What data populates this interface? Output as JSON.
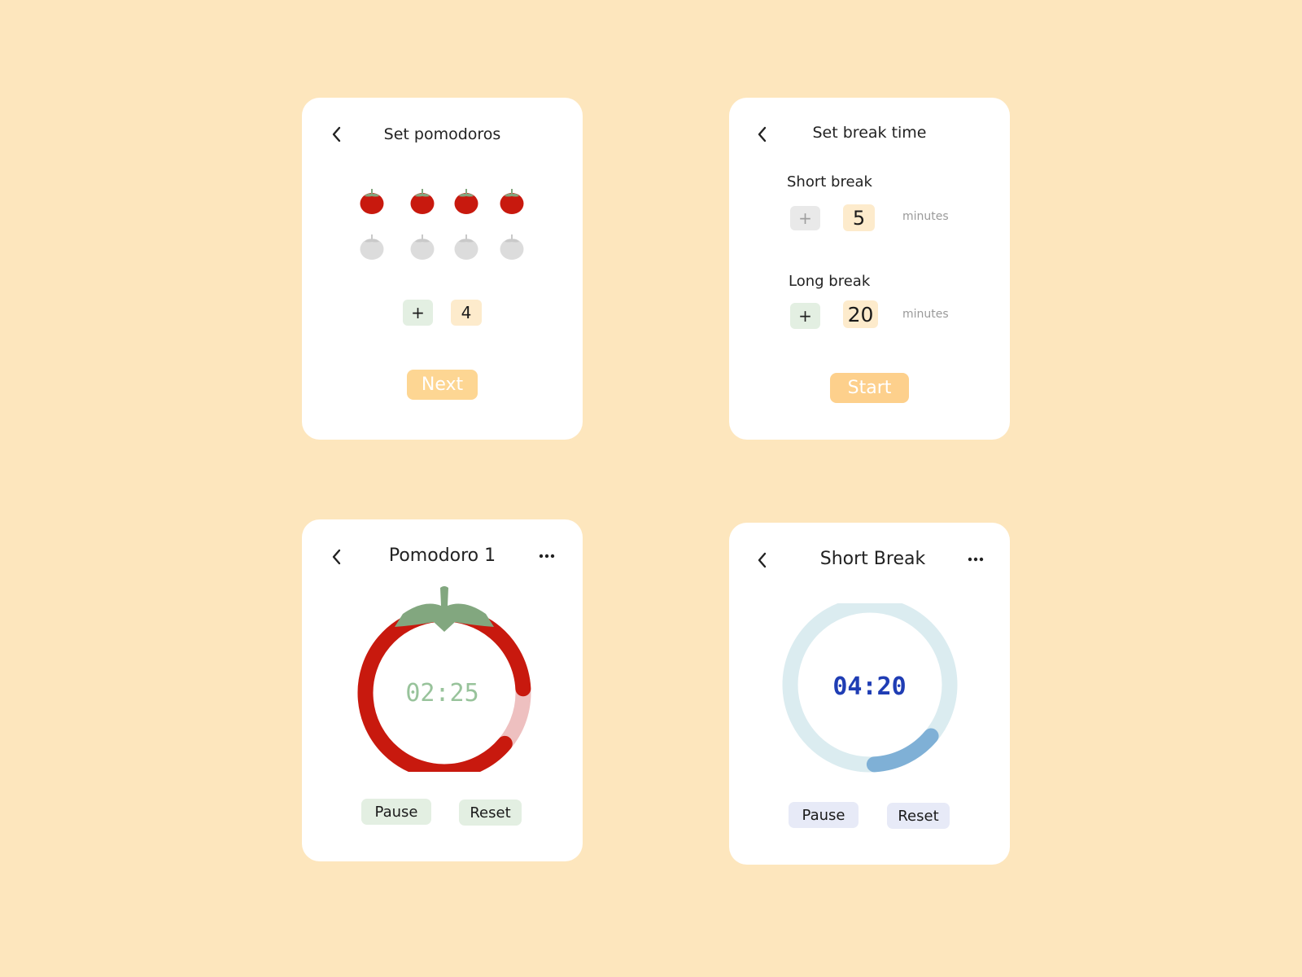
{
  "colors": {
    "background": "#fde6bd",
    "tomato_red": "#c8190e",
    "tomato_light": "#eec0c0",
    "tomato_gray": "#dcdcdc",
    "leaf_green": "#82a77f",
    "next_button": "#fdd693",
    "start_button": "#fdd08c",
    "value_chip": "#fdebcc",
    "green_chip": "#e3efe2",
    "blue_ring_track": "#dbecf0",
    "blue_ring_progress": "#7fb0d6",
    "blue_time": "#1f3db4",
    "green_time": "#98c39b",
    "lavender_button": "#e7eaf7"
  },
  "set_pomodoros": {
    "title": "Set pomodoros",
    "back_icon": "chevron-left-icon",
    "tomatoes_selected": 4,
    "tomatoes_total": 8,
    "plus_label": "+",
    "count": "4",
    "next_label": "Next"
  },
  "set_break": {
    "title": "Set break time",
    "back_icon": "chevron-left-icon",
    "short_break_label": "Short break",
    "short_plus": "+",
    "short_value": "5",
    "short_unit": "minutes",
    "long_break_label": "Long break",
    "long_plus": "+",
    "long_value": "20",
    "long_unit": "minutes",
    "start_label": "Start"
  },
  "pomodoro_timer": {
    "title": "Pomodoro 1",
    "back_icon": "chevron-left-icon",
    "more_icon": "more-horizontal-icon",
    "time": "02:25",
    "progress": 0.88,
    "pause_label": "Pause",
    "reset_label": "Reset"
  },
  "short_break_timer": {
    "title": "Short Break",
    "back_icon": "chevron-left-icon",
    "more_icon": "more-horizontal-icon",
    "time": "04:20",
    "progress": 0.13,
    "pause_label": "Pause",
    "reset_label": "Reset"
  }
}
